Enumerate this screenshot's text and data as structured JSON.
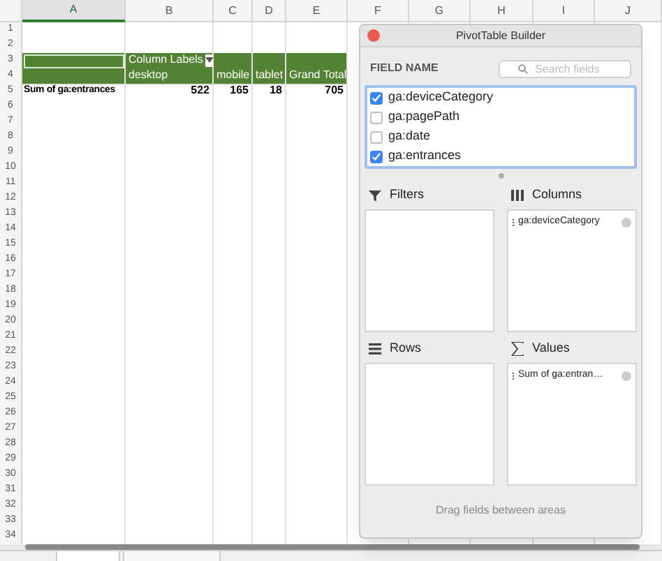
{
  "sheet": {
    "columns": [
      {
        "label": "A",
        "selected": true
      },
      {
        "label": "B",
        "selected": false
      },
      {
        "label": "C",
        "selected": false
      },
      {
        "label": "D",
        "selected": false
      },
      {
        "label": "E",
        "selected": false
      },
      {
        "label": "F",
        "selected": false
      },
      {
        "label": "G",
        "selected": false
      },
      {
        "label": "H",
        "selected": false
      },
      {
        "label": "I",
        "selected": false
      },
      {
        "label": "J",
        "selected": false
      }
    ],
    "row_numbers": [
      "1",
      "2",
      "3",
      "4",
      "5",
      "6",
      "7",
      "8",
      "9",
      "10",
      "11",
      "12",
      "13",
      "14",
      "15",
      "16",
      "17",
      "18",
      "19",
      "20",
      "21",
      "22",
      "23",
      "24",
      "25",
      "26",
      "27",
      "28",
      "29",
      "30",
      "31",
      "32",
      "33",
      "34"
    ]
  },
  "pivot": {
    "header_label": "Column Labels",
    "column_headers": [
      "desktop",
      "mobile",
      "tablet",
      "Grand Total"
    ],
    "row_label": "Sum of ga:entrances",
    "values": [
      "522",
      "165",
      "18",
      "705"
    ]
  },
  "builder": {
    "title": "PivotTable Builder",
    "field_name_label": "FIELD NAME",
    "search": {
      "placeholder": "Search fields"
    },
    "fields": [
      {
        "label": "ga:deviceCategory",
        "checked": true
      },
      {
        "label": "ga:pagePath",
        "checked": false
      },
      {
        "label": "ga:date",
        "checked": false
      },
      {
        "label": "ga:entrances",
        "checked": true
      }
    ],
    "areas": [
      {
        "kind": "filters",
        "label": "Filters"
      },
      {
        "kind": "columns",
        "label": "Columns",
        "items": [
          "ga:deviceCategory"
        ]
      },
      {
        "kind": "rows",
        "label": "Rows"
      },
      {
        "kind": "values",
        "label": "Values",
        "items": [
          "Sum of ga:entran…"
        ]
      }
    ],
    "footer": "Drag fields between areas"
  }
}
